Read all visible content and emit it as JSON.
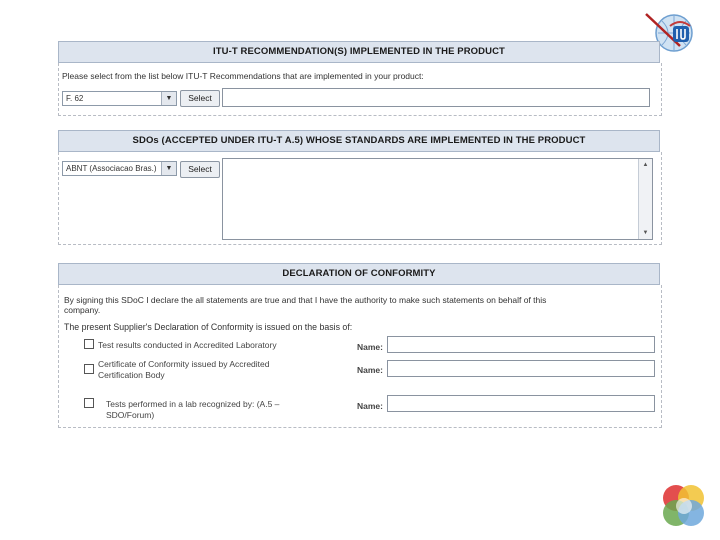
{
  "section1": {
    "title": "ITU-T RECOMMENDATION(S) IMPLEMENTED IN THE PRODUCT",
    "instruction": "Please select from the list below ITU-T Recommendations that are implemented in your product:",
    "select_value": "F. 62",
    "select_button": "Select"
  },
  "section2": {
    "title": "SDOs (ACCEPTED UNDER ITU-T A.5) WHOSE STANDARDS ARE IMPLEMENTED IN THE PRODUCT",
    "select_value": "ABNT (Associacao Bras.)",
    "select_button": "Select"
  },
  "section3": {
    "title": "DECLARATION OF CONFORMITY",
    "statement_line1": "By signing this SDoC I declare the all statements are true and that I have the authority to make such statements on behalf of this",
    "statement_line2": "company.",
    "basis_text": "The present Supplier's Declaration of Conformity is issued on the basis of:",
    "options": [
      {
        "label_line1": "Test results conducted in Accredited Laboratory",
        "label_line2": "",
        "name_label": "Name:"
      },
      {
        "label_line1": "Certificate of Conformity issued by Accredited",
        "label_line2": "Certification Body",
        "name_label": "Name:"
      },
      {
        "label_line1": "Tests performed in a lab recognized by: (A.5 –",
        "label_line2": "SDO/Forum)",
        "name_label": "Name:"
      }
    ]
  },
  "icons": {
    "arrow": "▼",
    "scroll_up": "▲",
    "scroll_down": "▼"
  }
}
